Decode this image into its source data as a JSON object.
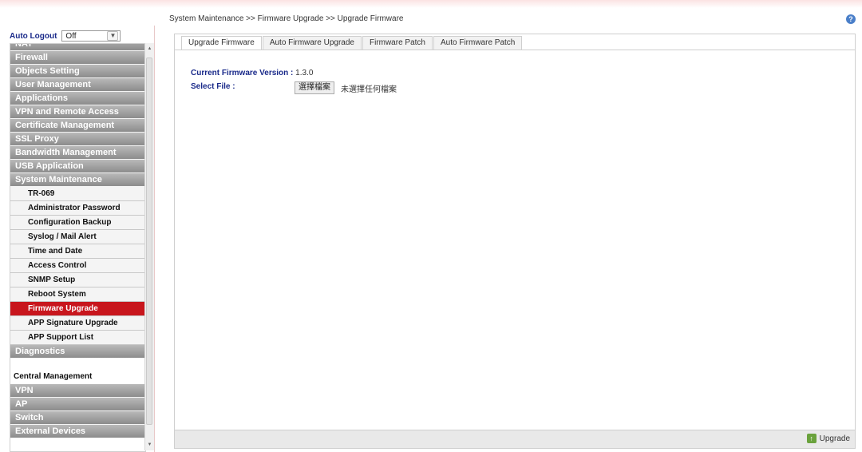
{
  "auto_logout": {
    "label": "Auto Logout",
    "value": "Off"
  },
  "menu": [
    {
      "type": "group",
      "label": "NAT"
    },
    {
      "type": "group",
      "label": "Firewall"
    },
    {
      "type": "group",
      "label": "Objects Setting"
    },
    {
      "type": "group",
      "label": "User Management"
    },
    {
      "type": "group",
      "label": "Applications"
    },
    {
      "type": "group",
      "label": "VPN and Remote Access"
    },
    {
      "type": "group",
      "label": "Certificate Management"
    },
    {
      "type": "group",
      "label": "SSL Proxy"
    },
    {
      "type": "group",
      "label": "Bandwidth Management"
    },
    {
      "type": "group",
      "label": "USB Application"
    },
    {
      "type": "group",
      "label": "System Maintenance"
    },
    {
      "type": "sub",
      "label": "TR-069"
    },
    {
      "type": "sub",
      "label": "Administrator Password"
    },
    {
      "type": "sub",
      "label": "Configuration Backup"
    },
    {
      "type": "sub",
      "label": "Syslog / Mail Alert"
    },
    {
      "type": "sub",
      "label": "Time and Date"
    },
    {
      "type": "sub",
      "label": "Access Control"
    },
    {
      "type": "sub",
      "label": "SNMP Setup"
    },
    {
      "type": "sub",
      "label": "Reboot System"
    },
    {
      "type": "sub",
      "label": "Firmware Upgrade",
      "active": true
    },
    {
      "type": "sub",
      "label": "APP Signature Upgrade"
    },
    {
      "type": "sub",
      "label": "APP Support List"
    },
    {
      "type": "group",
      "label": "Diagnostics"
    },
    {
      "type": "spacer"
    },
    {
      "type": "plain",
      "label": "Central Management"
    },
    {
      "type": "group",
      "label": "VPN"
    },
    {
      "type": "group",
      "label": "AP"
    },
    {
      "type": "group",
      "label": "Switch"
    },
    {
      "type": "group",
      "label": "External Devices"
    }
  ],
  "breadcrumb": "System Maintenance >> Firmware Upgrade >> Upgrade Firmware",
  "tabs": [
    "Upgrade Firmware",
    "Auto Firmware Upgrade",
    "Firmware Patch",
    "Auto Firmware Patch"
  ],
  "firmware": {
    "version_label": "Current Firmware Version :",
    "version_value": "1.3.0",
    "select_label": "Select File :",
    "choose_button": "選擇檔案",
    "no_file_text": "未選擇任何檔案"
  },
  "upgrade_button": "Upgrade",
  "colors": {
    "active_menu": "#c8161d",
    "group_bg": "#9e9e9e",
    "label_blue": "#1a2a8a"
  }
}
